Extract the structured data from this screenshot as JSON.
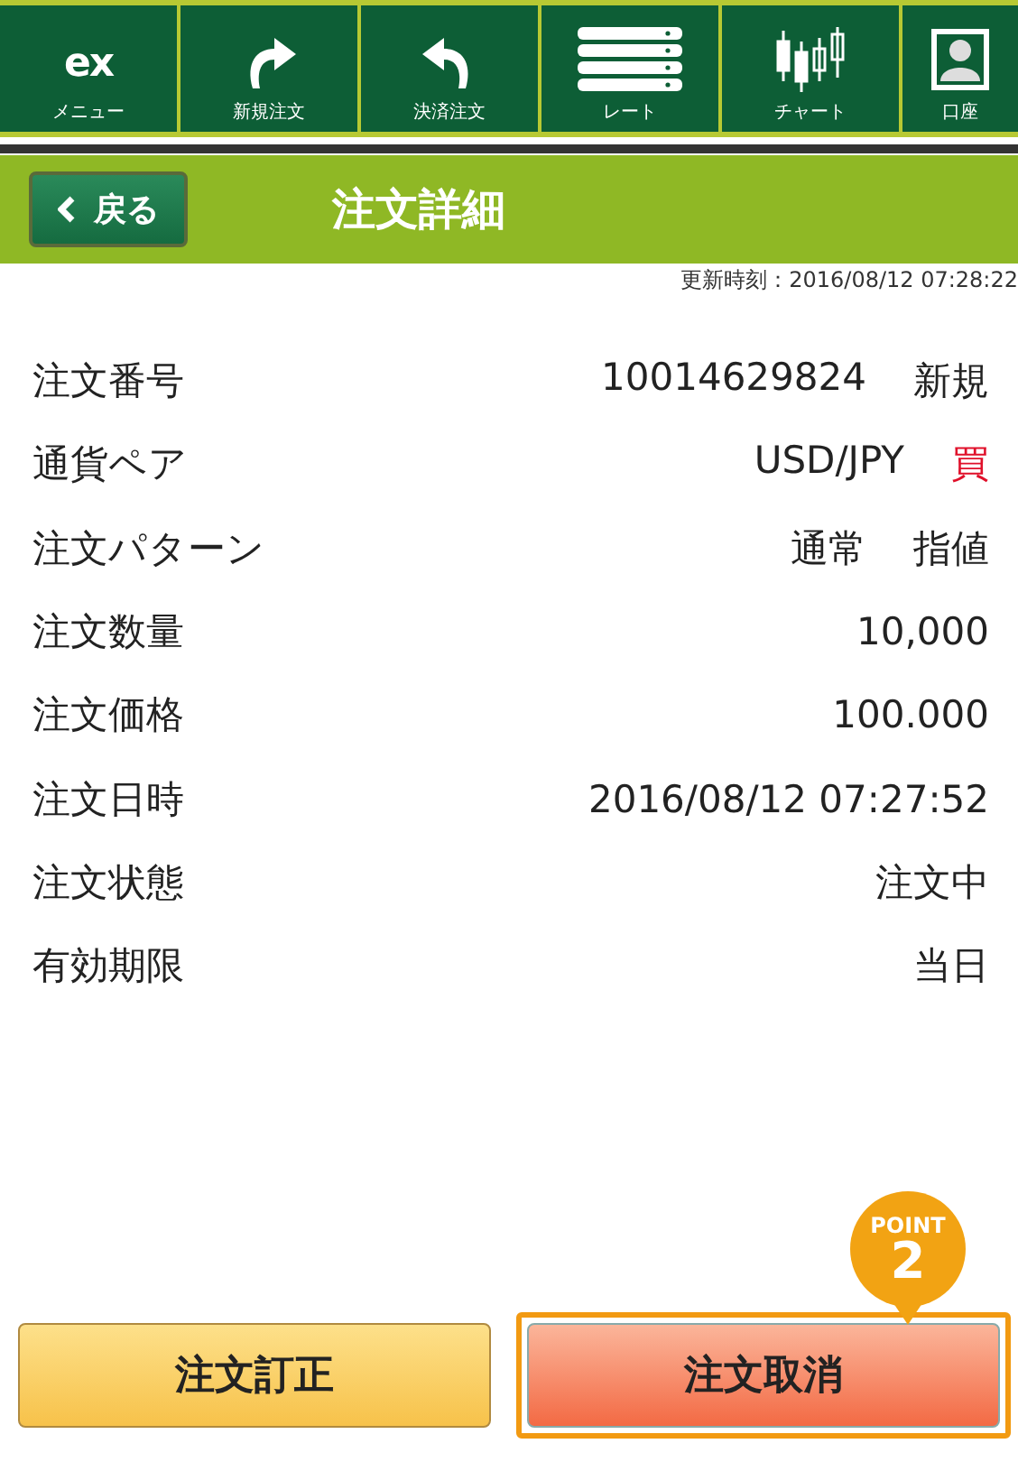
{
  "toolbar": [
    {
      "kind": "logo",
      "icon_text": "ex",
      "label": "メニュー"
    },
    {
      "kind": "redo",
      "label": "新規注文"
    },
    {
      "kind": "undo",
      "label": "決済注文"
    },
    {
      "kind": "list",
      "label": "レート"
    },
    {
      "kind": "candles",
      "label": "チャート"
    },
    {
      "kind": "person",
      "label": "口座"
    }
  ],
  "header": {
    "back": "戻る",
    "title": "注文詳細"
  },
  "updated": "更新時刻：2016/08/12 07:28:22",
  "rows": [
    {
      "label": "注文番号",
      "values": [
        {
          "text": "10014629824",
          "kind": "plain"
        },
        {
          "text": "新規",
          "kind": "plain"
        }
      ]
    },
    {
      "label": "通貨ペア",
      "values": [
        {
          "text": "USD/JPY",
          "kind": "plain"
        },
        {
          "text": "買",
          "kind": "buy"
        }
      ]
    },
    {
      "label": "注文パターン",
      "values": [
        {
          "text": "通常",
          "kind": "plain"
        },
        {
          "text": "指値",
          "kind": "plain"
        }
      ]
    },
    {
      "label": "注文数量",
      "values": [
        {
          "text": "10,000",
          "kind": "plain"
        }
      ]
    },
    {
      "label": "注文価格",
      "values": [
        {
          "text": "100.000",
          "kind": "plain"
        }
      ]
    },
    {
      "label": "注文日時",
      "values": [
        {
          "text": "2016/08/12 07:27:52",
          "kind": "plain"
        }
      ]
    },
    {
      "label": "注文状態",
      "values": [
        {
          "text": "注文中",
          "kind": "plain"
        }
      ]
    },
    {
      "label": "有効期限",
      "values": [
        {
          "text": "当日",
          "kind": "plain"
        }
      ]
    }
  ],
  "buttons": [
    {
      "label": "注文訂正",
      "kind": "secondary"
    },
    {
      "label": "注文取消",
      "kind": "primary",
      "badge": {
        "top": "POINT",
        "number": "2"
      }
    }
  ]
}
